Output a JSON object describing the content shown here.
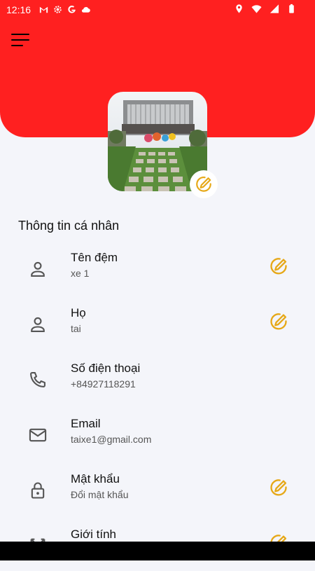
{
  "status_bar": {
    "time": "12:16",
    "left_icons": [
      "gmail-icon",
      "settings-gear-icon",
      "google-icon",
      "cloud-icon"
    ],
    "right_icons": [
      "location-icon",
      "wifi-icon",
      "signal-icon",
      "battery-icon"
    ]
  },
  "profile": {
    "section_title": "Thông tin cá nhân",
    "fields": [
      {
        "id": "middle-name",
        "label": "Tên đệm",
        "value": "xe 1",
        "icon": "person-icon",
        "editable": true
      },
      {
        "id": "last-name",
        "label": "Họ",
        "value": "tai",
        "icon": "person-icon",
        "editable": true
      },
      {
        "id": "phone",
        "label": "Số điện thoại",
        "value": "+84927118291",
        "icon": "phone-icon",
        "editable": false
      },
      {
        "id": "email",
        "label": "Email",
        "value": "taixe1@gmail.com",
        "icon": "mail-icon",
        "editable": false
      },
      {
        "id": "password",
        "label": "Mật khẩu",
        "value": "Đổi mật khẩu",
        "icon": "lock-icon",
        "editable": true
      },
      {
        "id": "gender",
        "label": "Giới tính",
        "value": "",
        "icon": "gender-icon",
        "editable": true
      }
    ]
  },
  "colors": {
    "header": "#ff2020",
    "accent": "#e6a817",
    "background": "#f4f5fa"
  }
}
